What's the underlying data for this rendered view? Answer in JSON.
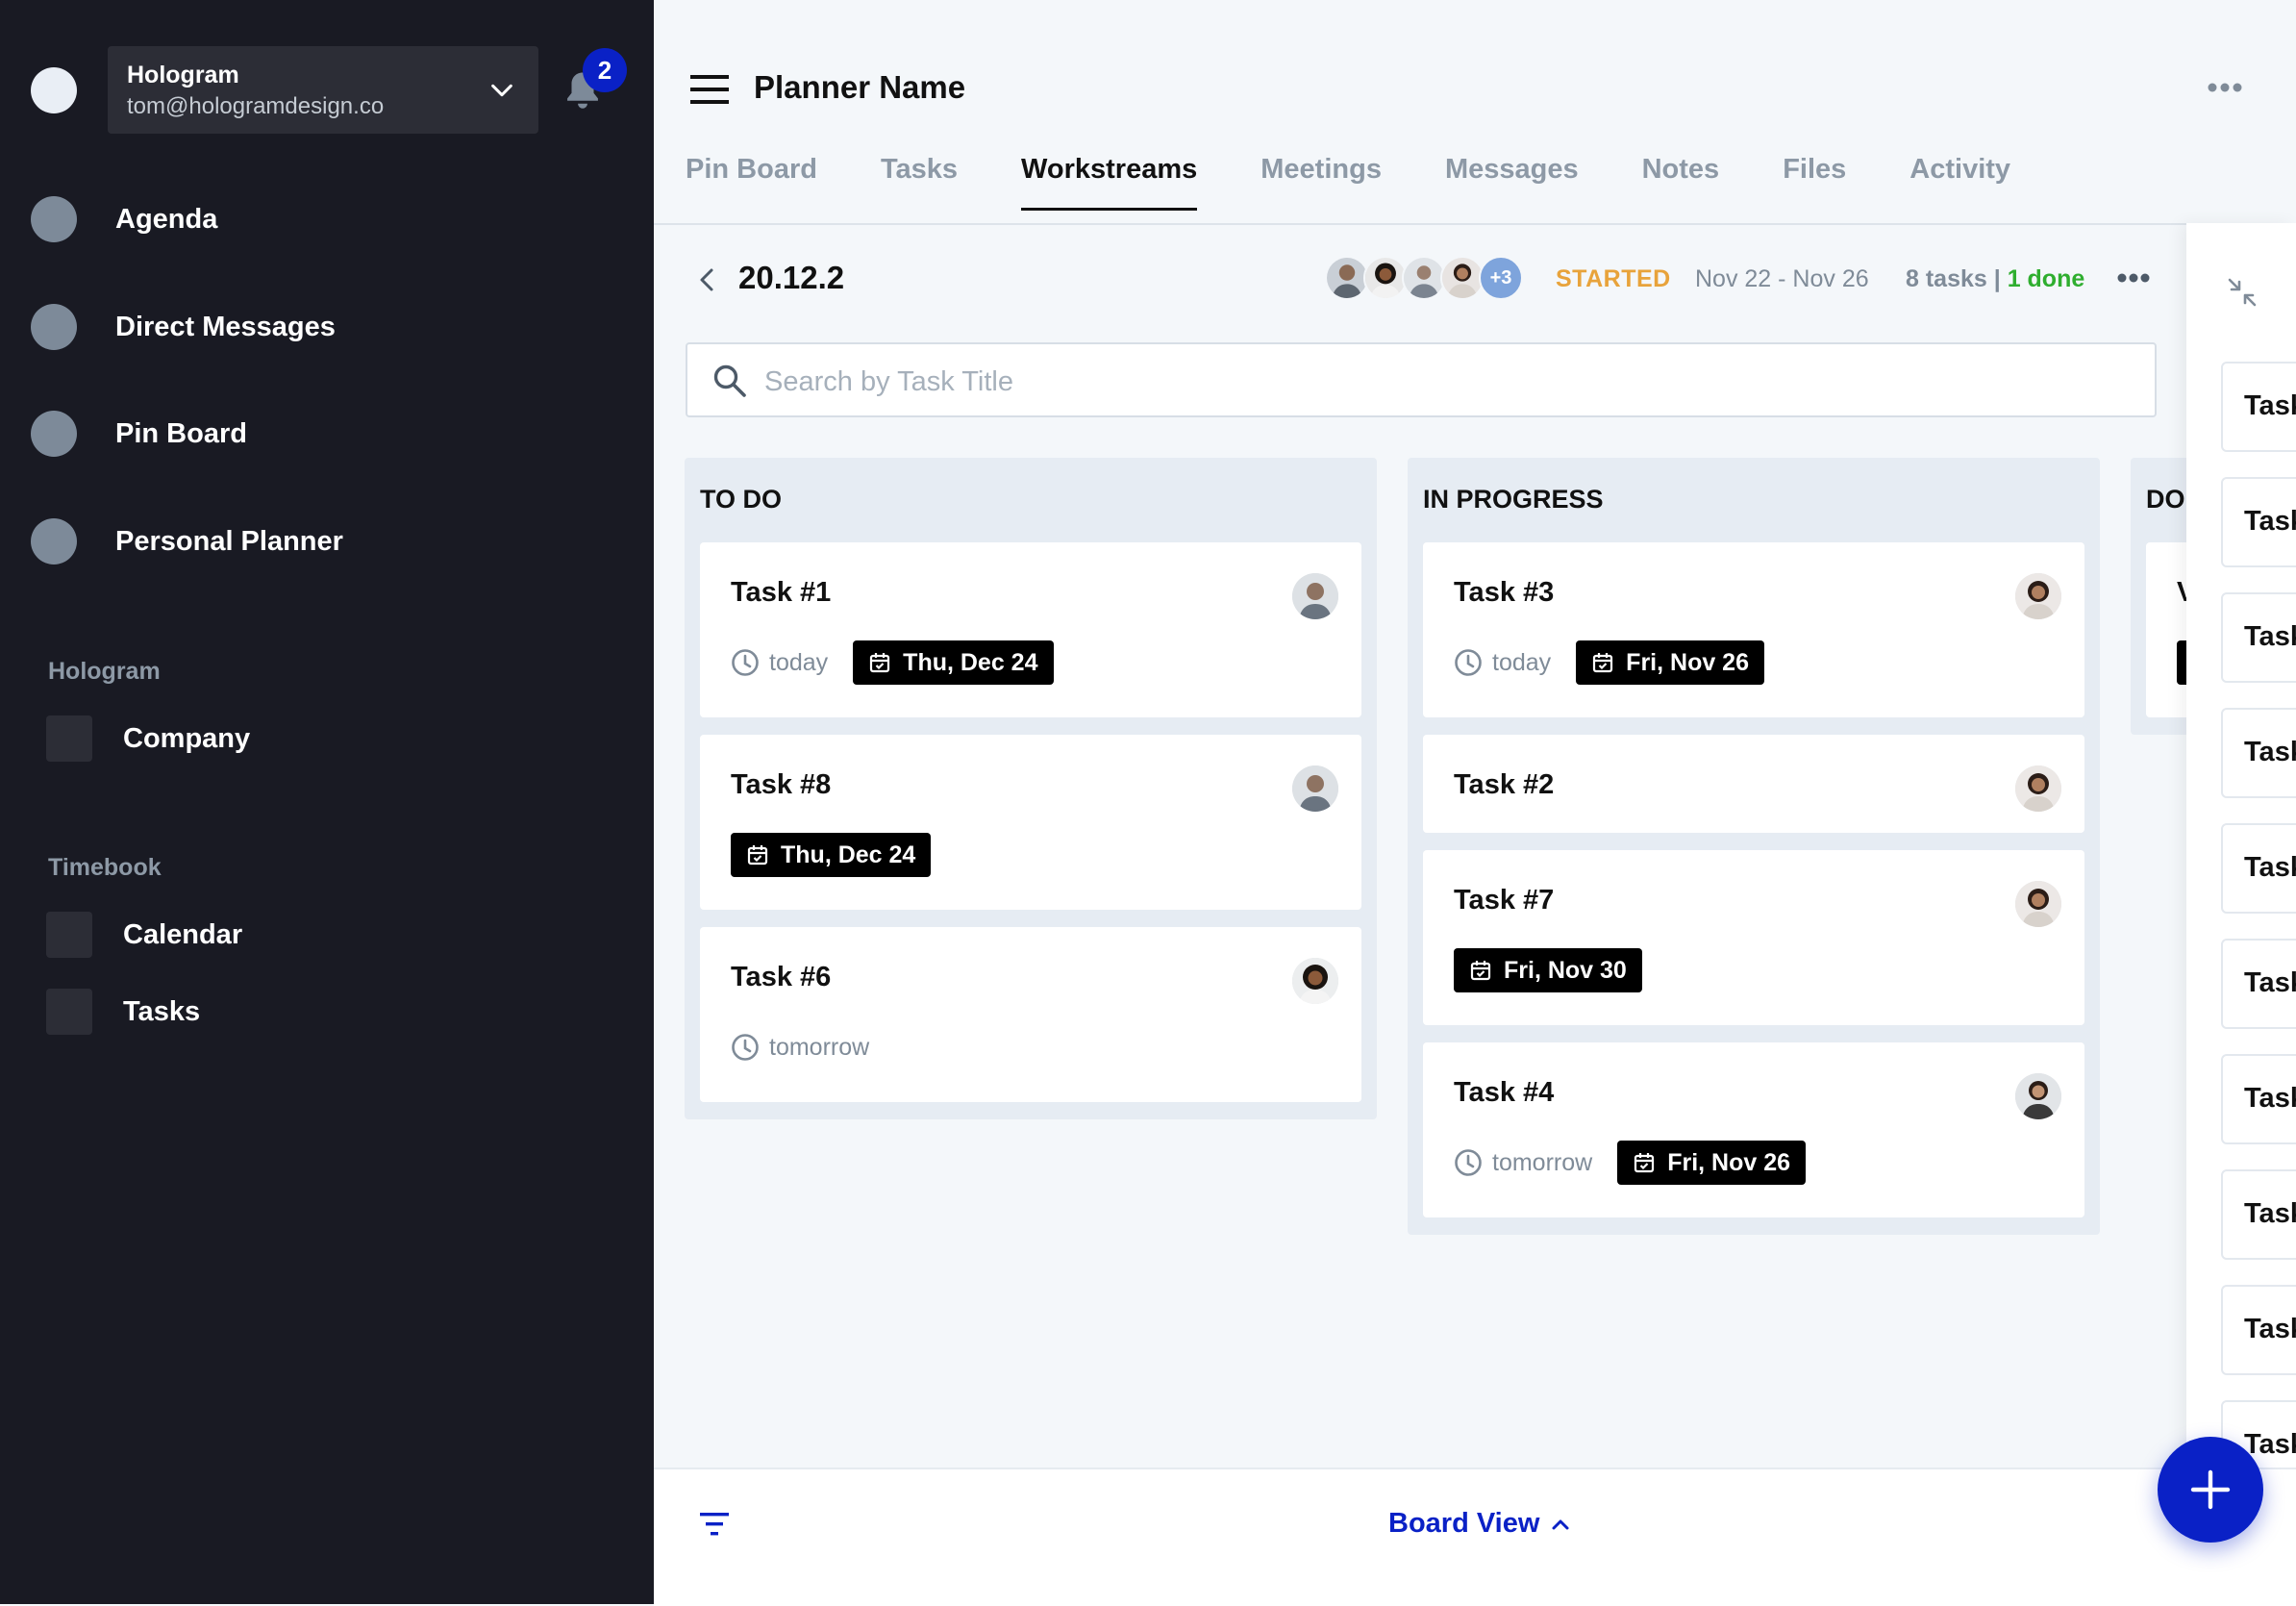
{
  "account": {
    "name": "Hologram",
    "email": "tom@hologramdesign.co",
    "notifications": "2"
  },
  "nav": [
    {
      "label": "Agenda"
    },
    {
      "label": "Direct Messages"
    },
    {
      "label": "Pin Board"
    },
    {
      "label": "Personal Planner"
    }
  ],
  "sections": [
    {
      "title": "Hologram",
      "items": [
        {
          "label": "Company"
        }
      ]
    },
    {
      "title": "Timebook",
      "items": [
        {
          "label": "Calendar"
        },
        {
          "label": "Tasks"
        }
      ]
    }
  ],
  "header": {
    "title": "Planner Name",
    "tabs": [
      "Pin Board",
      "Tasks",
      "Workstreams",
      "Meetings",
      "Messages",
      "Notes",
      "Files",
      "Activity"
    ],
    "active_tab": "Workstreams"
  },
  "sprint": {
    "name": "20.12.2",
    "extra_members": "+3",
    "status": "STARTED",
    "range": "Nov 22 - Nov 26",
    "tasks": "8 tasks",
    "separator": " | ",
    "done": "1 done"
  },
  "search": {
    "placeholder": "Search by Task Title"
  },
  "columns": [
    {
      "title": "TO DO",
      "cards": [
        {
          "title": "Task #1",
          "relative": "today",
          "date": "Thu, Dec 24"
        },
        {
          "title": "Task #8",
          "date": "Thu, Dec 24"
        },
        {
          "title": "Task #6",
          "relative": "tomorrow"
        }
      ]
    },
    {
      "title": "IN PROGRESS",
      "cards": [
        {
          "title": "Task #3",
          "relative": "today",
          "date": "Fri, Nov 26"
        },
        {
          "title": "Task #2"
        },
        {
          "title": "Task #7",
          "date": "Fri, Nov 30"
        },
        {
          "title": "Task #4",
          "relative": "tomorrow",
          "date": "Fri, Nov 26"
        }
      ]
    },
    {
      "title": "DO",
      "cards": [
        {
          "title": "V"
        }
      ]
    }
  ],
  "side_panel": {
    "task_label": "Task"
  },
  "bottom": {
    "view": "Board View"
  },
  "colors": {
    "sidebar": "#191a23",
    "accent": "#0a21c6",
    "started": "#e8a33b",
    "done": "#2fae2f"
  }
}
